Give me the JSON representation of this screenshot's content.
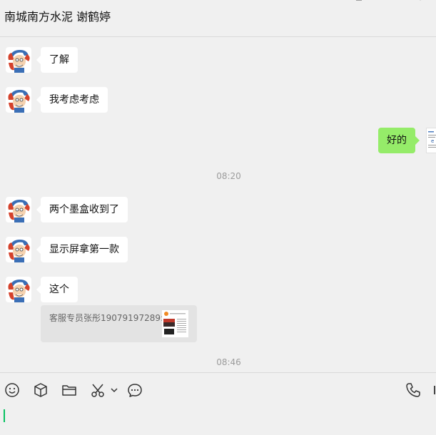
{
  "header": {
    "title": "南城南方水泥 谢鹤婷"
  },
  "messages": [
    {
      "side": "left",
      "text": "了解"
    },
    {
      "side": "left",
      "text": "我考虑考虑"
    },
    {
      "side": "right",
      "text": "好的"
    },
    {
      "type": "time",
      "text": "08:20"
    },
    {
      "side": "left",
      "text": "两个墨盒收到了"
    },
    {
      "side": "left",
      "text": "显示屏拿第一款"
    },
    {
      "side": "left",
      "text": "这个"
    },
    {
      "type": "quote",
      "text": "客服专员张彤19079197289:"
    },
    {
      "type": "time",
      "text": "08:46"
    }
  ],
  "toolbar": {
    "icons": [
      "emoji-icon",
      "box-icon",
      "folder-icon",
      "scissors-icon",
      "chevron-down-icon",
      "chat-bubble-icon",
      "phone-icon",
      "video-icon"
    ]
  },
  "colors": {
    "background": "#f0f0f0",
    "bubble_self": "#95ec69",
    "bubble_other": "#ffffff",
    "caret": "#07c160"
  }
}
